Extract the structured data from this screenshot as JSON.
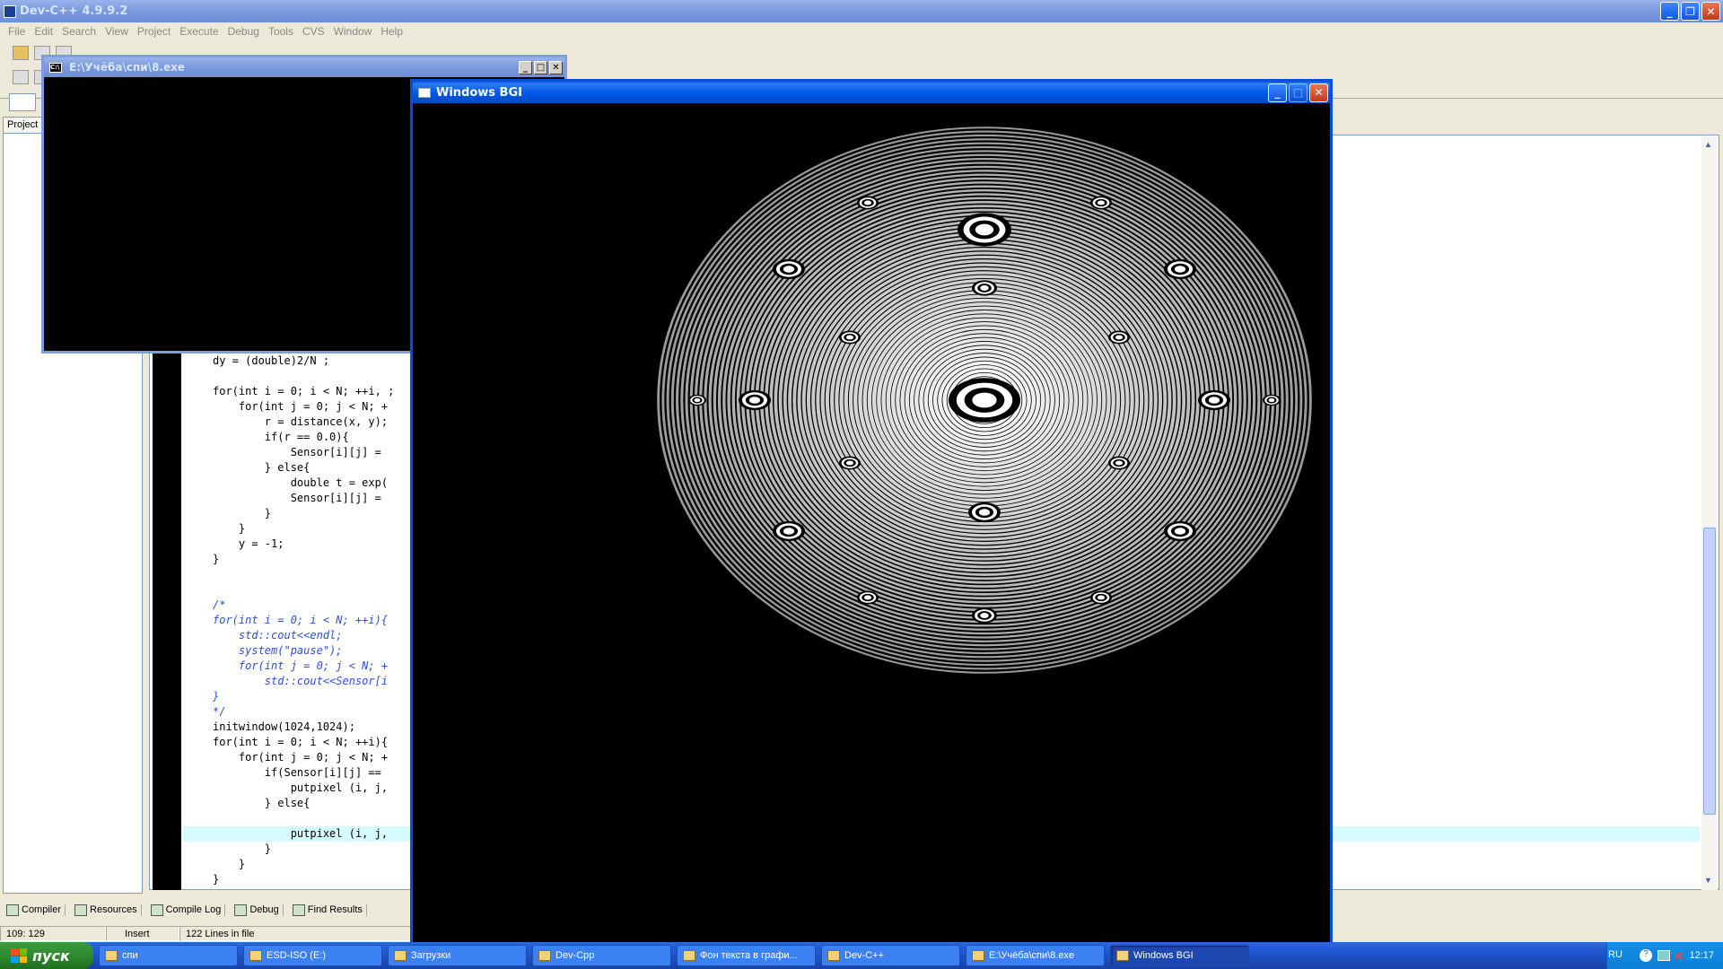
{
  "devcpp": {
    "title": "Dev-C++ 4.9.9.2",
    "menu": [
      "File",
      "Edit",
      "Search",
      "View",
      "Project",
      "Execute",
      "Debug",
      "Tools",
      "CVS",
      "Window",
      "Help"
    ],
    "project_tab": "Project",
    "code_lines": [
      {
        "text": "dy = (double)2/N ;",
        "cls": ""
      },
      {
        "text": "",
        "cls": ""
      },
      {
        "text": "for(int i = 0; i < N; ++i, ;",
        "cls": ""
      },
      {
        "text": "    for(int j = 0; j < N; +",
        "cls": ""
      },
      {
        "text": "        r = distance(x, y);",
        "cls": ""
      },
      {
        "text": "        if(r == 0.0){",
        "cls": ""
      },
      {
        "text": "            Sensor[i][j] = ",
        "cls": ""
      },
      {
        "text": "        } else{",
        "cls": ""
      },
      {
        "text": "            double t = exp(",
        "cls": ""
      },
      {
        "text": "            Sensor[i][j] = ",
        "cls": ""
      },
      {
        "text": "        }",
        "cls": ""
      },
      {
        "text": "    }",
        "cls": ""
      },
      {
        "text": "    y = -1;",
        "cls": ""
      },
      {
        "text": "}",
        "cls": ""
      },
      {
        "text": "",
        "cls": ""
      },
      {
        "text": "",
        "cls": ""
      },
      {
        "text": "/*",
        "cls": "cmt"
      },
      {
        "text": "for(int i = 0; i < N; ++i){",
        "cls": "cmt"
      },
      {
        "text": "    std::cout<<endl;",
        "cls": "cmt"
      },
      {
        "text": "    system(\"pause\");",
        "cls": "cmt"
      },
      {
        "text": "    for(int j = 0; j < N; +",
        "cls": "cmt"
      },
      {
        "text": "        std::cout<<Sensor[i",
        "cls": "cmt"
      },
      {
        "text": "}",
        "cls": "cmt"
      },
      {
        "text": "*/",
        "cls": "cmt"
      },
      {
        "text": "initwindow(1024,1024);",
        "cls": ""
      },
      {
        "text": "for(int i = 0; i < N; ++i){",
        "cls": ""
      },
      {
        "text": "    for(int j = 0; j < N; +",
        "cls": ""
      },
      {
        "text": "        if(Sensor[i][j] == ",
        "cls": ""
      },
      {
        "text": "            putpixel (i, j,",
        "cls": ""
      },
      {
        "text": "        } else{",
        "cls": ""
      },
      {
        "text": "",
        "cls": ""
      },
      {
        "text": "            putpixel (i, j,",
        "cls": ""
      },
      {
        "text": "        }",
        "cls": ""
      },
      {
        "text": "    }",
        "cls": ""
      },
      {
        "text": "}",
        "cls": ""
      }
    ],
    "bottom_tabs": [
      "Compiler",
      "Resources",
      "Compile Log",
      "Debug",
      "Find Results"
    ],
    "status": {
      "position": "109: 129",
      "mode": "Insert",
      "lines": "122 Lines in file"
    }
  },
  "console": {
    "title": "E:\\Учёба\\спи\\8.exe"
  },
  "bgi": {
    "title": "Windows BGI"
  },
  "taskbar": {
    "start": "пуск",
    "tasks": [
      "спи",
      "ESD-ISO (E:)",
      "Загрузки",
      "Dev-Cpp",
      "Фон текста в графи...",
      "Dev-C++",
      "E:\\Учёба\\спи\\8.exe",
      "Windows BGI"
    ],
    "lang": "RU",
    "clock": "12:17"
  }
}
